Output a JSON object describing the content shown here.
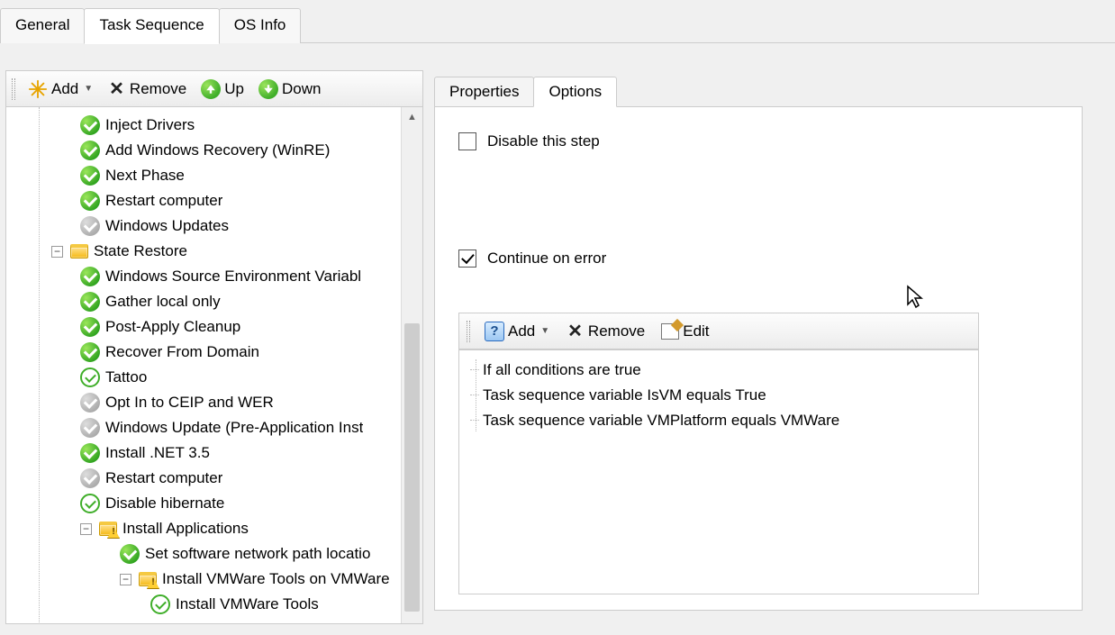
{
  "topTabs": {
    "general": "General",
    "taskSequence": "Task Sequence",
    "osInfo": "OS Info",
    "active": "taskSequence"
  },
  "leftToolbar": {
    "add": "Add",
    "remove": "Remove",
    "up": "Up",
    "down": "Down"
  },
  "tree": {
    "items": [
      {
        "label": "Inject Drivers",
        "icon": "green",
        "indent": 1
      },
      {
        "label": "Add Windows Recovery (WinRE)",
        "icon": "green",
        "indent": 1
      },
      {
        "label": "Next Phase",
        "icon": "green",
        "indent": 1
      },
      {
        "label": "Restart computer",
        "icon": "green",
        "indent": 1
      },
      {
        "label": "Windows Updates",
        "icon": "gray",
        "indent": 1
      },
      {
        "label": "State Restore",
        "icon": "folder",
        "indent": 0,
        "expander": "minus"
      },
      {
        "label": "Windows Source Environment Variabl",
        "icon": "green",
        "indent": 1
      },
      {
        "label": "Gather local only",
        "icon": "green",
        "indent": 1
      },
      {
        "label": "Post-Apply Cleanup",
        "icon": "green",
        "indent": 1
      },
      {
        "label": "Recover From Domain",
        "icon": "green",
        "indent": 1
      },
      {
        "label": "Tattoo",
        "icon": "green-outline",
        "indent": 1
      },
      {
        "label": "Opt In to CEIP and WER",
        "icon": "gray",
        "indent": 1
      },
      {
        "label": "Windows Update (Pre-Application Inst",
        "icon": "gray",
        "indent": 1
      },
      {
        "label": "Install .NET 3.5",
        "icon": "green",
        "indent": 1
      },
      {
        "label": "Restart computer",
        "icon": "gray",
        "indent": 1
      },
      {
        "label": "Disable hibernate",
        "icon": "green-outline",
        "indent": 1
      },
      {
        "label": "Install Applications",
        "icon": "folder-warn",
        "indent": 1,
        "expander": "minus"
      },
      {
        "label": "Set software network path locatio",
        "icon": "green",
        "indent": 2
      },
      {
        "label": "Install VMWare Tools on VMWare",
        "icon": "folder-warn",
        "indent": 2,
        "expander": "minus"
      },
      {
        "label": "Install VMWare Tools",
        "icon": "green-outline",
        "indent": 3
      }
    ]
  },
  "rightTabs": {
    "properties": "Properties",
    "options": "Options",
    "active": "options"
  },
  "options": {
    "disableLabel": "Disable this step",
    "disableChecked": false,
    "continueLabel": "Continue on error",
    "continueChecked": true
  },
  "condToolbar": {
    "add": "Add",
    "remove": "Remove",
    "edit": "Edit"
  },
  "conditions": [
    "If all conditions are true",
    "Task sequence variable IsVM equals True",
    "Task sequence variable VMPlatform equals VMWare"
  ]
}
